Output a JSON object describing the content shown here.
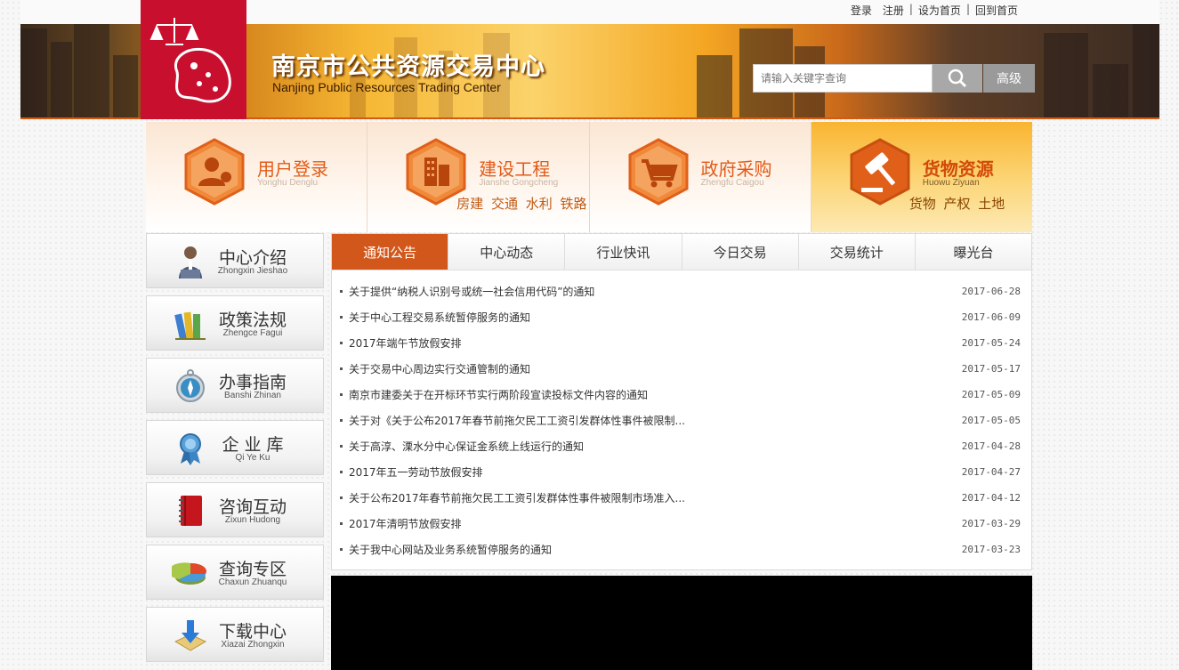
{
  "topbar": {
    "login": "登录",
    "register": "注册",
    "set_home": "设为首页",
    "back_home": "回到首页",
    "sep": "|"
  },
  "header": {
    "title": "南京市公共资源交易中心",
    "subtitle": "Nanjing Public Resources Trading Center",
    "search_placeholder": "请输入关键字查询",
    "advanced_label": "高级"
  },
  "categories": [
    {
      "title": "用户登录",
      "pinyin": "Yonghu Denglu",
      "tags": "",
      "icon": "user-login-icon"
    },
    {
      "title": "建设工程",
      "pinyin": "Jianshe Gongcheng",
      "tags": "房建 交通 水利 铁路",
      "icon": "building-icon"
    },
    {
      "title": "政府采购",
      "pinyin": "Zhengfu Caigou",
      "tags": "",
      "icon": "shopping-cart-icon"
    },
    {
      "title": "货物资源",
      "pinyin": "Huowu Ziyuan",
      "tags": "货物  产权  土地",
      "icon": "gavel-icon"
    }
  ],
  "menu": [
    {
      "title": "中心介绍",
      "pinyin": "Zhongxin Jieshao",
      "icon": "person-icon"
    },
    {
      "title": "政策法规",
      "pinyin": "Zhengce Fagui",
      "icon": "books-icon"
    },
    {
      "title": "办事指南",
      "pinyin": "Banshi Zhinan",
      "icon": "compass-icon"
    },
    {
      "title": "企 业 库",
      "pinyin": "Qi  Ye  Ku",
      "icon": "award-icon"
    },
    {
      "title": "咨询互动",
      "pinyin": "Zixun Hudong",
      "icon": "notebook-icon"
    },
    {
      "title": "查询专区",
      "pinyin": "Chaxun Zhuanqu",
      "icon": "pie-chart-icon"
    },
    {
      "title": "下载中心",
      "pinyin": "Xiazai Zhongxin",
      "icon": "download-icon"
    }
  ],
  "tabs": [
    "通知公告",
    "中心动态",
    "行业快讯",
    "今日交易",
    "交易统计",
    "曝光台"
  ],
  "news": [
    {
      "title": "关于提供“纳税人识别号或统一社会信用代码”的通知",
      "date": "2017-06-28"
    },
    {
      "title": "关于中心工程交易系统暂停服务的通知",
      "date": "2017-06-09"
    },
    {
      "title": "2017年端午节放假安排",
      "date": "2017-05-24"
    },
    {
      "title": "关于交易中心周边实行交通管制的通知",
      "date": "2017-05-17"
    },
    {
      "title": "南京市建委关于在开标环节实行两阶段宣读投标文件内容的通知",
      "date": "2017-05-09"
    },
    {
      "title": "关于对《关于公布2017年春节前拖欠民工工资引发群体性事件被限制...",
      "date": "2017-05-05"
    },
    {
      "title": "关于高淳、溧水分中心保证金系统上线运行的通知",
      "date": "2017-04-28"
    },
    {
      "title": "2017年五一劳动节放假安排",
      "date": "2017-04-27"
    },
    {
      "title": "关于公布2017年春节前拖欠民工工资引发群体性事件被限制市场准入...",
      "date": "2017-04-12"
    },
    {
      "title": "2017年清明节放假安排",
      "date": "2017-03-29"
    },
    {
      "title": "关于我中心网站及业务系统暂停服务的通知",
      "date": "2017-03-23"
    }
  ],
  "colors": {
    "accent": "#d2571a",
    "logo_red": "#c8102e",
    "category_text": "#e25b18"
  }
}
